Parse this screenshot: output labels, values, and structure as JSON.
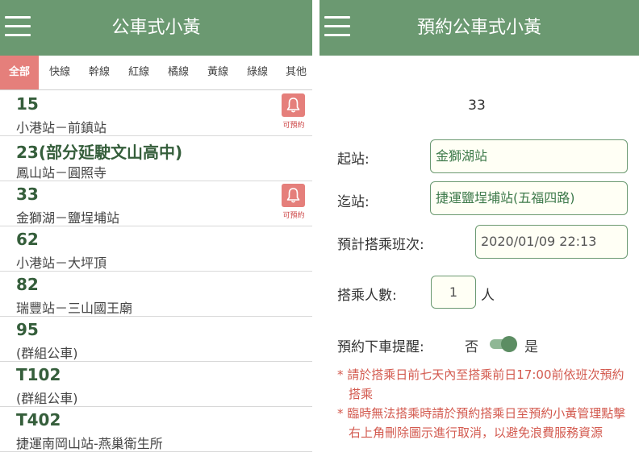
{
  "list_screen": {
    "title": "公車式小黃",
    "tabs": [
      "全部",
      "快線",
      "幹線",
      "紅線",
      "橘線",
      "黃線",
      "綠線",
      "其他"
    ],
    "reservable_label": "可預約",
    "routes": [
      {
        "number": "15",
        "stops": "小港站－前鎮站",
        "reservable": true
      },
      {
        "number": "23(部分延駛文山高中)",
        "stops": "鳳山站－圓照寺",
        "reservable": false
      },
      {
        "number": "33",
        "stops": "金獅湖－鹽埕埔站",
        "reservable": true
      },
      {
        "number": "62",
        "stops": "小港站－大坪頂",
        "reservable": false
      },
      {
        "number": "82",
        "stops": "瑞豐站－三山國王廟",
        "reservable": false
      },
      {
        "number": "95",
        "stops": "(群組公車)",
        "reservable": false
      },
      {
        "number": "T102",
        "stops": "(群組公車)",
        "reservable": false
      },
      {
        "number": "T402",
        "stops": "捷運南岡山站-燕巢衛生所",
        "reservable": false
      }
    ]
  },
  "reserve_screen": {
    "title": "預約公車式小黃",
    "route_number": "33",
    "start_label": "起站:",
    "start_value": "金獅湖站",
    "end_label": "迄站:",
    "end_value": "捷運鹽埕埔站(五福四路)",
    "schedule_label": "預計搭乘班次:",
    "schedule_value": "2020/01/09 22:13",
    "passengers_label": "搭乘人數:",
    "passengers_value": "1",
    "passengers_unit": "人",
    "reminder_label": "預約下車提醒:",
    "reminder_off": "否",
    "reminder_on": "是",
    "reminder_enabled": true,
    "notes": [
      "* 請於搭乘日前七天內至搭乘前日17:00前依班次預約搭乘",
      "* 臨時無法搭乘時請於預約搭乘日至預約小黃管理點擊右上角刪除圖示進行取消，以避免浪費服務資源"
    ]
  },
  "colors": {
    "header": "#6b9971",
    "active_tab": "#e57f7b",
    "route_number": "#355e3b",
    "note_text": "#d35a4f"
  }
}
